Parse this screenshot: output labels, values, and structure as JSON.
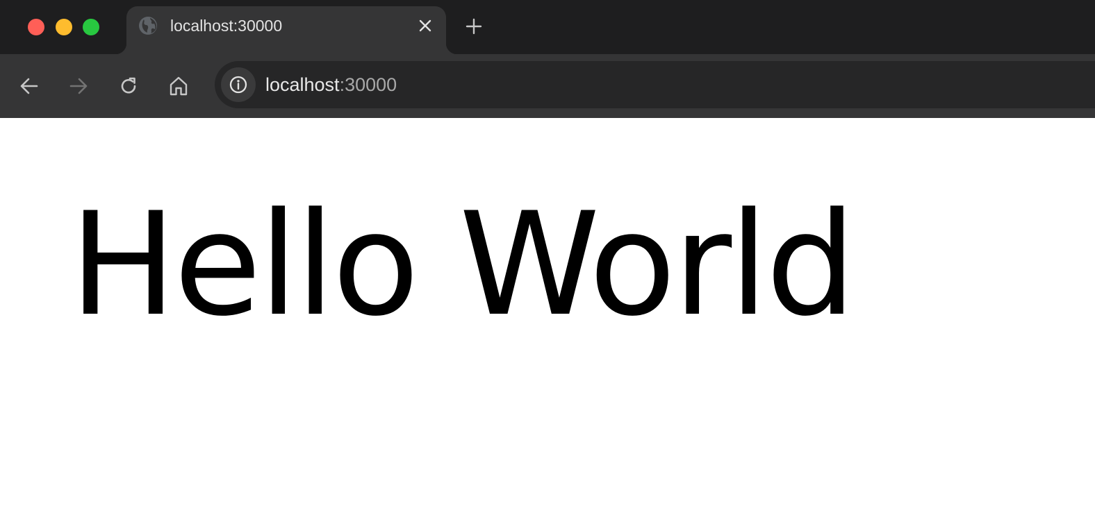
{
  "window": {
    "traffic_lights": {
      "close_color": "#ff5f57",
      "minimize_color": "#febc2e",
      "zoom_color": "#28c840"
    }
  },
  "tabs": [
    {
      "title": "localhost:30000",
      "favicon": "globe-icon",
      "active": true
    }
  ],
  "tab_controls": {
    "close_icon": "close-icon",
    "new_tab_icon": "plus-icon"
  },
  "toolbar": {
    "back_icon": "arrow-left-icon",
    "forward_icon": "arrow-right-icon",
    "forward_enabled": false,
    "reload_icon": "reload-icon",
    "home_icon": "home-icon"
  },
  "address_bar": {
    "site_info_icon": "info-icon",
    "host": "localhost",
    "port": ":30000"
  },
  "page": {
    "heading": "Hello World"
  },
  "colors": {
    "tabstrip_bg": "#1e1e1f",
    "toolbar_bg": "#353536",
    "omnibox_bg": "#262627",
    "page_bg": "#ffffff"
  }
}
